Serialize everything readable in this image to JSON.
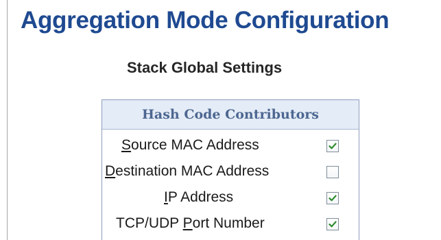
{
  "page": {
    "title": "Aggregation Mode Configuration",
    "section_title": "Stack Global Settings"
  },
  "hash_table": {
    "header": "Hash Code Contributors",
    "rows": [
      {
        "label_pre": "",
        "accesskey": "S",
        "label_post": "ource MAC Address",
        "checked": true
      },
      {
        "label_pre": "",
        "accesskey": "D",
        "label_post": "estination MAC Address",
        "checked": false
      },
      {
        "label_pre": "",
        "accesskey": "I",
        "label_post": "P Address",
        "checked": true
      },
      {
        "label_pre": "TCP/UDP ",
        "accesskey": "P",
        "label_post": "ort Number",
        "checked": true
      }
    ]
  },
  "colors": {
    "title": "#1f4a91",
    "table_header_bg": "#e4ecf7",
    "table_header_text": "#4d6791",
    "checkmark": "#2e8b2e"
  }
}
